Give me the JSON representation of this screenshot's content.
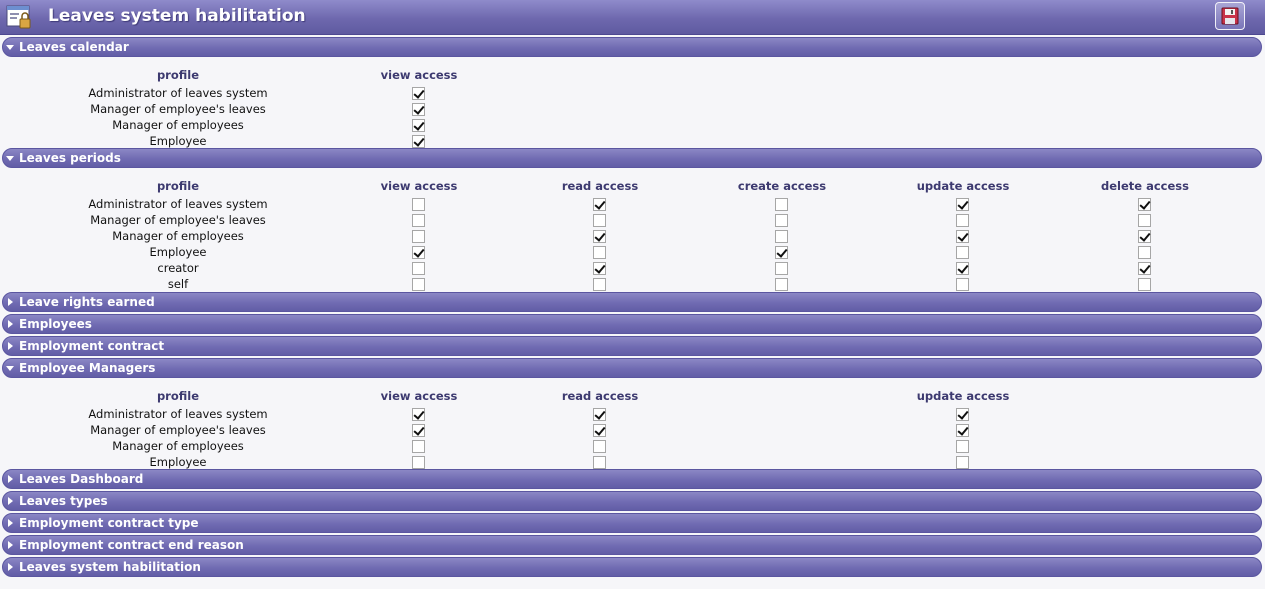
{
  "title": "Leaves system habilitation",
  "icons": {
    "app": "app-window-lock-icon",
    "save": "floppy-disk-icon"
  },
  "columns": {
    "profile": "profile",
    "view": "view access",
    "read": "read access",
    "create": "create access",
    "update": "update access",
    "delete": "delete access"
  },
  "sections": {
    "leaves_calendar": {
      "label": "Leaves calendar",
      "expanded": true,
      "rows": [
        {
          "profile": "Administrator of leaves system",
          "view": true
        },
        {
          "profile": "Manager of employee's leaves",
          "view": true
        },
        {
          "profile": "Manager of employees",
          "view": true
        },
        {
          "profile": "Employee",
          "view": true
        }
      ]
    },
    "leaves_periods": {
      "label": "Leaves periods",
      "expanded": true,
      "rows": [
        {
          "profile": "Administrator of leaves system",
          "view": false,
          "read": true,
          "create": false,
          "update": true,
          "delete": true
        },
        {
          "profile": "Manager of employee's leaves",
          "view": false,
          "read": false,
          "create": false,
          "update": false,
          "delete": false
        },
        {
          "profile": "Manager of employees",
          "view": false,
          "read": true,
          "create": false,
          "update": true,
          "delete": true
        },
        {
          "profile": "Employee",
          "view": true,
          "read": false,
          "create": true,
          "update": false,
          "delete": false
        },
        {
          "profile": "creator",
          "view": false,
          "read": true,
          "create": false,
          "update": true,
          "delete": true
        },
        {
          "profile": "self",
          "view": false,
          "read": false,
          "create": false,
          "update": false,
          "delete": false
        }
      ]
    },
    "leave_rights_earned": {
      "label": "Leave rights earned",
      "expanded": false
    },
    "employees": {
      "label": "Employees",
      "expanded": false
    },
    "employment_contract": {
      "label": "Employment contract",
      "expanded": false
    },
    "employee_managers": {
      "label": "Employee Managers",
      "expanded": true,
      "rows": [
        {
          "profile": "Administrator of leaves system",
          "view": true,
          "read": true,
          "update": true
        },
        {
          "profile": "Manager of employee's leaves",
          "view": true,
          "read": true,
          "update": true
        },
        {
          "profile": "Manager of employees",
          "view": false,
          "read": false,
          "update": false
        },
        {
          "profile": "Employee",
          "view": false,
          "read": false,
          "update": false
        }
      ]
    },
    "leaves_dashboard": {
      "label": "Leaves Dashboard",
      "expanded": false
    },
    "leaves_types": {
      "label": "Leaves types",
      "expanded": false
    },
    "employment_contract_type": {
      "label": "Employment contract type",
      "expanded": false
    },
    "employment_contract_end_reason": {
      "label": "Employment contract end reason",
      "expanded": false
    },
    "leaves_system_habilitation": {
      "label": "Leaves system habilitation",
      "expanded": false
    }
  }
}
